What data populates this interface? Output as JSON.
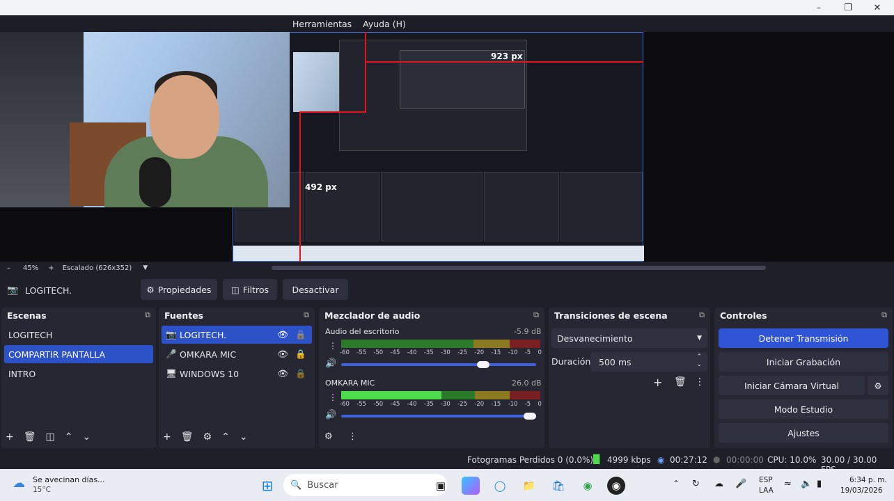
{
  "menu": {
    "items": [
      "Herramientas",
      "Ayuda (H)"
    ]
  },
  "preview": {
    "measure_width": "923 px",
    "measure_height": "492 px",
    "zoom": "45%",
    "scaling": "Escalado (626x352)"
  },
  "source_toolbar": {
    "source_name": "LOGITECH.",
    "properties_label": "Propiedades",
    "filters_label": "Filtros",
    "deactivate_label": "Desactivar"
  },
  "scenes": {
    "title": "Escenas",
    "items": [
      "LOGITECH",
      "COMPARTIR PANTALLA",
      "INTRO"
    ],
    "selected_index": 1
  },
  "sources": {
    "title": "Fuentes",
    "items": [
      {
        "label": "LOGITECH.",
        "icon": "camera-icon"
      },
      {
        "label": "OMKARA MIC",
        "icon": "microphone-icon"
      },
      {
        "label": "WINDOWS 10",
        "icon": "monitor-icon"
      }
    ],
    "selected_index": 0
  },
  "mixer": {
    "title": "Mezclador de audio",
    "tick_labels": [
      "-60",
      "-55",
      "-50",
      "-45",
      "-40",
      "-35",
      "-30",
      "-25",
      "-20",
      "-15",
      "-10",
      "-5",
      "0"
    ],
    "channels": [
      {
        "name": "Audio del escritorio",
        "level": "-5.9 dB",
        "volume_fraction": 0.76
      },
      {
        "name": "OMKARA MIC",
        "level": "26.0 dB",
        "volume_fraction": 1.0
      }
    ]
  },
  "transitions": {
    "title": "Transiciones de escena",
    "selected": "Desvanecimiento",
    "duration_label": "Duración",
    "duration_value": "500 ms"
  },
  "controls": {
    "title": "Controles",
    "stop_stream": "Detener Transmisión",
    "start_recording": "Iniciar Grabación",
    "start_virtual_cam": "Iniciar Cámara Virtual",
    "studio_mode": "Modo Estudio",
    "settings": "Ajustes"
  },
  "status": {
    "dropped_frames": "Fotogramas Perdidos 0 (0.0%)",
    "bitrate": "4999 kbps",
    "stream_time": "00:27:12",
    "record_time": "00:00:00",
    "cpu": "CPU: 10.0%",
    "fps": "30.00 / 30.00 FPS"
  },
  "taskbar": {
    "weather_text": "Se avecinan días...",
    "temperature": "15°C",
    "search_placeholder": "Buscar",
    "lang_top": "ESP",
    "lang_bottom": "LAA",
    "time": "6:34 p. m.",
    "date": "19/03/2026"
  },
  "colors": {
    "accent": "#2d52c8",
    "stream_active": "#2f54d6",
    "meter_green": "#4edc4e",
    "meter_yellow": "#8c7a22",
    "meter_red": "#7a1f22"
  }
}
